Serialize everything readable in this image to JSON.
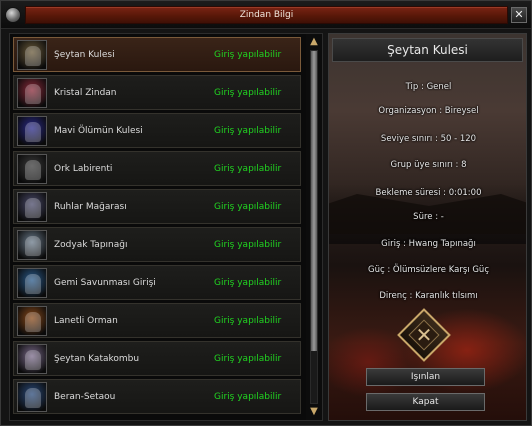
{
  "window": {
    "title": "Zindan Bilgi",
    "close_glyph": "✕"
  },
  "list": {
    "items": [
      {
        "name": "Şeytan Kulesi",
        "status": "Giriş yapılabilir",
        "icon": "tower-demon-icon",
        "thumb_color": "#6a5a3a",
        "selected": true
      },
      {
        "name": "Kristal Zindan",
        "status": "Giriş yapılabilir",
        "icon": "crystal-monster-icon",
        "thumb_color": "#8a2a3a",
        "selected": false
      },
      {
        "name": "Mavi Ölümün Kulesi",
        "status": "Giriş yapılabilir",
        "icon": "blue-death-icon",
        "thumb_color": "#2a2a8a",
        "selected": false
      },
      {
        "name": "Ork Labirenti",
        "status": "Giriş yapılabilir",
        "icon": "orc-icon",
        "thumb_color": "#3a3a3a",
        "selected": false
      },
      {
        "name": "Ruhlar Mağarası",
        "status": "Giriş yapılabilir",
        "icon": "spirit-icon",
        "thumb_color": "#4a4a6a",
        "selected": false
      },
      {
        "name": "Zodyak Tapınağı",
        "status": "Giriş yapılabilir",
        "icon": "zodiac-icon",
        "thumb_color": "#6a7a8a",
        "selected": false
      },
      {
        "name": "Gemi Savunması Girişi",
        "status": "Giriş yapılabilir",
        "icon": "sea-serpent-icon",
        "thumb_color": "#2a5a8a",
        "selected": false
      },
      {
        "name": "Lanetli Orman",
        "status": "Giriş yapılabilir",
        "icon": "cursed-forest-icon",
        "thumb_color": "#8a4a1a",
        "selected": false
      },
      {
        "name": "Şeytan Katakombu",
        "status": "Giriş yapılabilir",
        "icon": "catacomb-icon",
        "thumb_color": "#7a6a8a",
        "selected": false
      },
      {
        "name": "Beran-Setaou",
        "status": "Giriş yapılabilir",
        "icon": "dragon-icon",
        "thumb_color": "#2a4a7a",
        "selected": false
      }
    ]
  },
  "scrollbar": {
    "up_glyph": "▲",
    "down_glyph": "▼"
  },
  "detail": {
    "title": "Şeytan Kulesi",
    "lines": [
      "Tip : Genel",
      "Organizasyon : Bireysel",
      "Seviye sınırı : 50 - 120",
      "Grup üye sınırı : 8",
      "Bekleme süresi : 0:01:00",
      "Süre : -",
      "Giriş : Hwang Tapınağı",
      "Güç : Ölümsüzlere Karşı Güç",
      "Direnç : Karanlık tılsımı"
    ],
    "emblem_glyph": "✕",
    "teleport_label": "Işınlan",
    "close_label": "Kapat"
  },
  "colors": {
    "status_green": "#21d321",
    "title_red": "#561708",
    "accent_gold": "#c9a86a"
  }
}
